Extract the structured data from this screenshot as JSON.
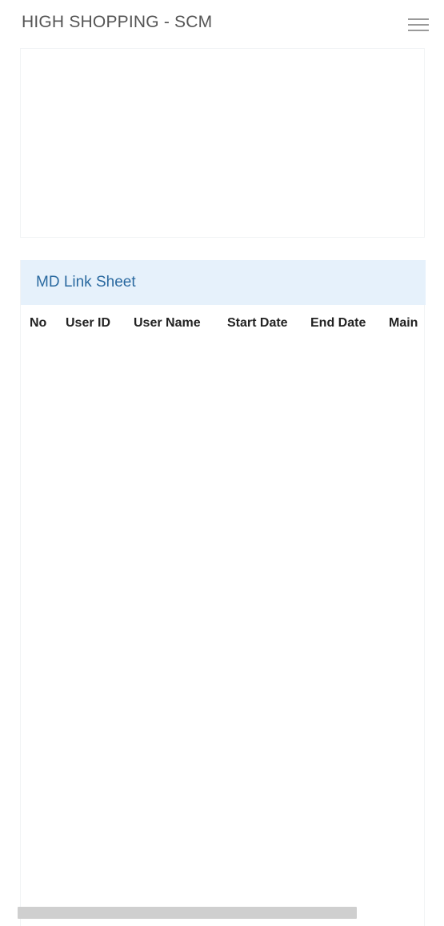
{
  "header": {
    "title": "HIGH SHOPPING - SCM",
    "menu_icon": "hamburger-menu-icon"
  },
  "sheet": {
    "title": "MD Link Sheet",
    "columns": [
      "No",
      "User ID",
      "User Name",
      "Start Date",
      "End Date",
      "Main"
    ],
    "rows": []
  },
  "colors": {
    "sheet_heading_bg": "#e6f1fb",
    "sheet_title": "#2b6aa0",
    "app_title": "#555555"
  }
}
